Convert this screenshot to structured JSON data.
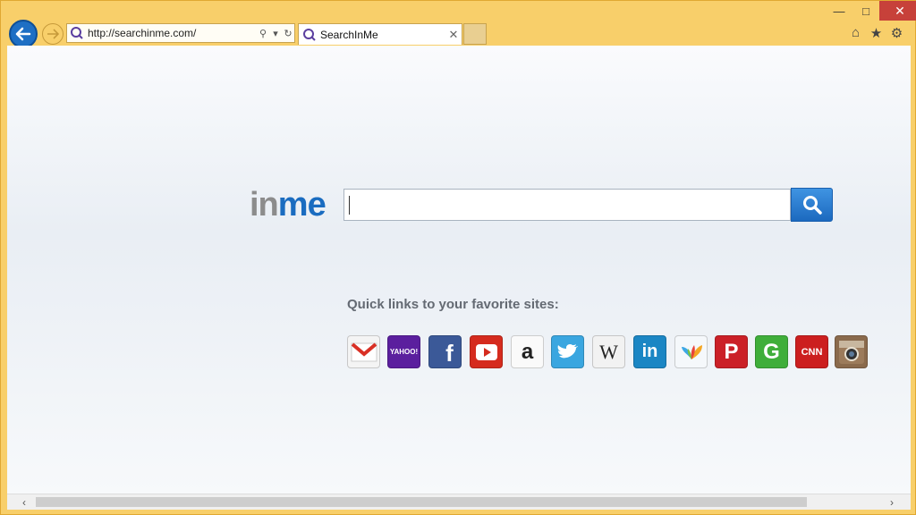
{
  "browser": {
    "address_url": "http://searchinme.com/",
    "tab_title": "SearchInMe",
    "controls": {
      "minimize": "—",
      "maximize": "□",
      "close": "✕"
    }
  },
  "page": {
    "logo_in": "in",
    "logo_me": "me",
    "search_value": "",
    "quick_links_title": "Quick links to your favorite sites:",
    "quick_links": [
      {
        "name": "Gmail",
        "glyph": "M"
      },
      {
        "name": "Yahoo",
        "glyph": "YAHOO!"
      },
      {
        "name": "Facebook",
        "glyph": "f"
      },
      {
        "name": "YouTube",
        "glyph": "▶"
      },
      {
        "name": "Amazon",
        "glyph": "a"
      },
      {
        "name": "Twitter",
        "glyph": "🐦"
      },
      {
        "name": "Wikipedia",
        "glyph": "W"
      },
      {
        "name": "LinkedIn",
        "glyph": "in"
      },
      {
        "name": "MSN",
        "glyph": "✿"
      },
      {
        "name": "Pinterest",
        "glyph": "P"
      },
      {
        "name": "Google",
        "glyph": "G"
      },
      {
        "name": "CNN",
        "glyph": "CNN"
      },
      {
        "name": "Instagram",
        "glyph": "◉"
      }
    ]
  },
  "colors": {
    "frame": "#f8cf6a",
    "accent_blue": "#1a6cc0",
    "logo_gray": "#8c8c8c"
  }
}
